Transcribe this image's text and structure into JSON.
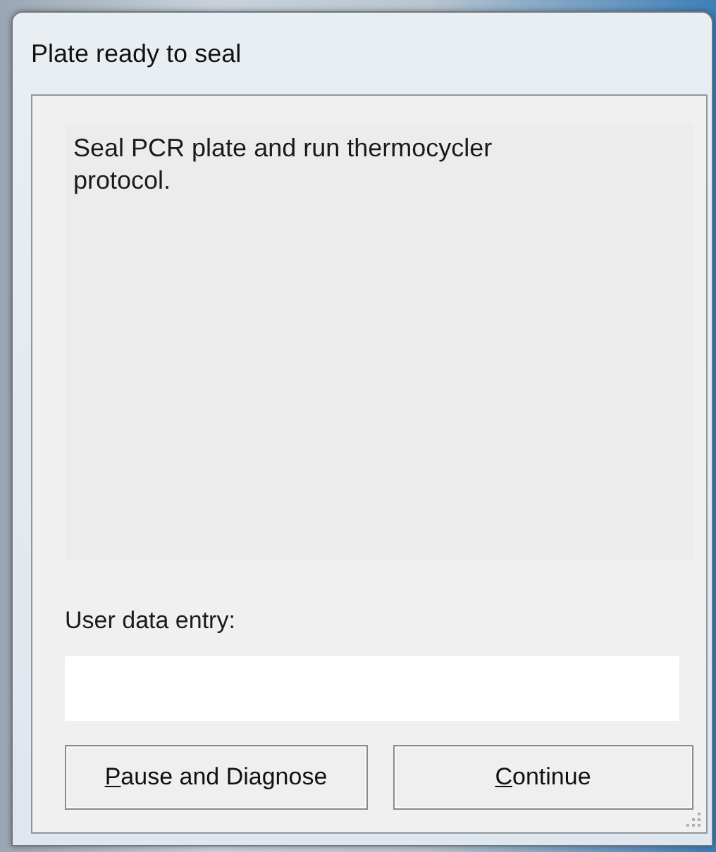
{
  "window": {
    "title": "Plate ready to seal"
  },
  "message": "Seal PCR plate and run thermocycler protocol.",
  "entry": {
    "label": "User data entry:"
  },
  "buttons": [
    {
      "mnemonic": "P",
      "rest": "ause and Diagnose"
    },
    {
      "mnemonic": "C",
      "rest": "ontinue"
    }
  ]
}
